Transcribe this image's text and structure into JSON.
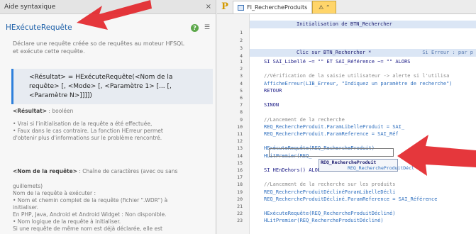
{
  "help_panel": {
    "title": "Aide syntaxique",
    "close": "×",
    "function_name": "HExécuteRequête",
    "description_lines": [
      "Déclare une requête créée so                     de requêtes au moteur HFSQL",
      "et exécute cette requête."
    ],
    "syntax": {
      "line1": "<Résultat> = HExécuteRequête(<Nom de la",
      "line2": "requête> [, <Mode> [, <Paramètre 1> [... [,",
      "line3": "<Paramètre N>]]]])"
    },
    "result_label": "<Résultat>",
    "result_type": " : booléen",
    "result_lines": [
      "• Vrai si l'initialisation de la requête a été effectuée,",
      "• Faux dans le cas contraire. La fonction  HErreur permet",
      "d'obtenir plus d'informations sur le problème rencontré."
    ],
    "param_label": "<Nom de la requête>",
    "param_type": " : Chaîne de caractères (avec ou sans",
    "param_lines": [
      "guillemets)",
      "Nom de la requête à exécuter :",
      "• Nom et chemin complet de la requête (fichier \".WDR\") à",
      "initialiser.",
      "En PHP, Java, Android et Android Widget : Non disponible.",
      "• Nom logique de la requête à initialiser.",
      "Si une requête de même nom est déjà déclarée, elle est"
    ]
  },
  "tabs": {
    "logo": "P",
    "tab1": "FI_RechercheProduits",
    "tab2": "⚠ ⌃"
  },
  "editor": {
    "section1": {
      "title": "Initialisation de BTN_Rechercher",
      "number": "1"
    },
    "lines_top": [
      "2",
      "3",
      "4"
    ],
    "section2": {
      "title": "Clic sur BTN_Rechercher  *",
      "right": "Si Erreur : par p"
    },
    "lines": [
      {
        "n": "1",
        "code": "SI SAI_Libellé ~= \"\" ET SAI_Référence ~= \"\"  ALORS"
      },
      {
        "n": "2",
        "code": ""
      },
      {
        "n": "3",
        "code": "    //Vérification de la saisie utilisateur -> alerte si l'utilisa"
      },
      {
        "n": "4",
        "code": "    AfficheErreur(LIB_Erreur, \"Indiquez un paramètre de recherche\")"
      },
      {
        "n": "5",
        "code": "    RETOUR"
      },
      {
        "n": "6",
        "code": ""
      },
      {
        "n": "7",
        "code": "SINON"
      },
      {
        "n": "8",
        "code": ""
      },
      {
        "n": "9",
        "code": "    //Lancement de la recherche"
      },
      {
        "n": "10",
        "code": "    REQ_RechercheProduit.ParamLibelleProduit = SAI_"
      },
      {
        "n": "11",
        "code": "    REQ_RechercheProduit.ParamReference = SAI_Réf"
      },
      {
        "n": "12",
        "code": ""
      },
      {
        "n": "13",
        "code": "    HExécuteRequête(REQ_RechercheProduit)"
      },
      {
        "n": "14",
        "code": "    HLitPremier(REQ_"
      },
      {
        "n": "15",
        "code": ""
      },
      {
        "n": "16",
        "code": "    SI HEnDehors() ALORS"
      },
      {
        "n": "17",
        "code": ""
      },
      {
        "n": "18",
        "code": "        //Lancement de la recherche sur les produits"
      },
      {
        "n": "19",
        "code": "        REQ_RechercheProduitDéclinéParamLibelleDécli"
      },
      {
        "n": "20",
        "code": "        REQ_RechercheProduitDécliné.ParamReference = SAI_Référence"
      },
      {
        "n": "21",
        "code": ""
      },
      {
        "n": "22",
        "code": "        HExécuteRequête(REQ_RechercheProduitDécliné)"
      },
      {
        "n": "23",
        "code": "        HLitPremier(REQ_RechercheProduitDécliné)"
      }
    ],
    "autocomplete": {
      "item1": "REQ_RechercheProduit",
      "item2": "REQ_RechercheProduitDécl"
    }
  },
  "colors": {
    "accent_blue": "#2d7fdb",
    "arrow_red": "#e3262b",
    "tab_code_yellow": "#ffd56a"
  }
}
